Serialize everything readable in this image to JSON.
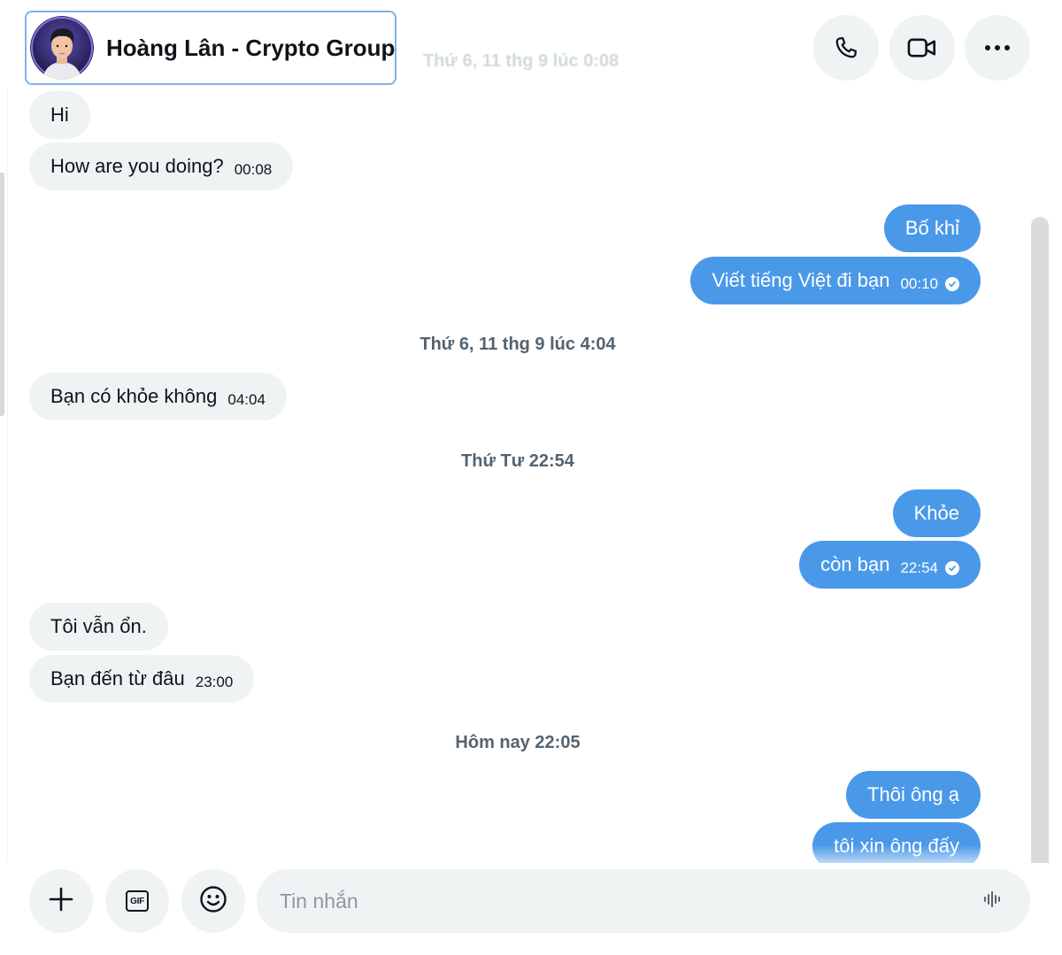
{
  "header": {
    "contact_name": "Hoàng Lân - Crypto Group",
    "ghost_date": "Thứ 6, 11 thg 9 lúc 0:08"
  },
  "messages": {
    "m1": {
      "text": "Hi"
    },
    "m2": {
      "text": "How are you doing?",
      "time": "00:08"
    },
    "m3": {
      "text": "Bố khỉ"
    },
    "m4": {
      "text": "Viết tiếng Việt đi bạn",
      "time": "00:10"
    },
    "sep1": "Thứ 6, 11 thg 9 lúc 4:04",
    "m5": {
      "text": "Bạn có khỏe không",
      "time": "04:04"
    },
    "sep2": "Thứ Tư 22:54",
    "m6": {
      "text": "Khỏe"
    },
    "m7": {
      "text": "còn bạn",
      "time": "22:54"
    },
    "m8": {
      "text": "Tôi vẫn ổn."
    },
    "m9": {
      "text": "Bạn đến từ đâu",
      "time": "23:00"
    },
    "sep3": "Hôm nay 22:05",
    "m10": {
      "text": "Thôi ông ạ"
    },
    "m11": {
      "text": "tôi xin ông đấy"
    }
  },
  "composer": {
    "placeholder": "Tin nhắn",
    "gif_label": "GIF"
  },
  "icons": {
    "call": "phone-icon",
    "video": "video-camera-icon",
    "more": "more-dots-icon",
    "add": "plus-icon",
    "gif": "gif-icon",
    "emoji": "emoji-icon",
    "voice": "voice-wave-icon",
    "read": "read-check-icon"
  },
  "colors": {
    "outgoing_bubble": "#4a99e9",
    "incoming_bubble": "#eff3f4",
    "focus_border": "#7fb3e8"
  }
}
